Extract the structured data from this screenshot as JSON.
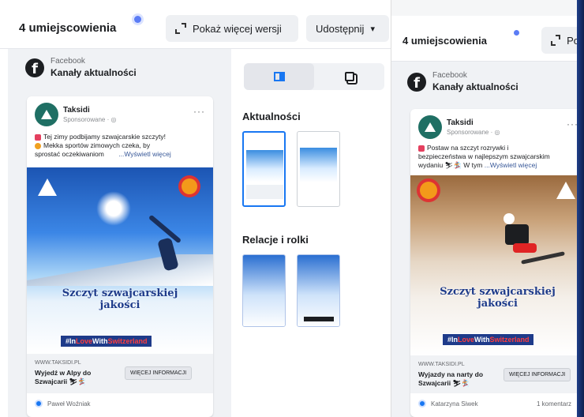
{
  "left": {
    "locations_title": "4 umiejscowienia",
    "show_more_versions": "Pokaż więcej wersji",
    "share_label": "Udostępnij",
    "share_caret": "▾",
    "platform": "Facebook",
    "placement_name": "Kanały aktualności",
    "fb_glyph": "f",
    "post": {
      "brand": "Taksidi",
      "sponsored": "Sponsorowane · ◎",
      "menu": "···",
      "caption_line1": "Tej zimy podbijamy szwajcarskie szczyty!",
      "caption_line2": "Mekka sportów zimowych czeka, by",
      "caption_line3": "sprostać oczekiwaniom",
      "see_more": "...Wyświetl więcej",
      "headline_line1": "Szczyt szwajcarskiej",
      "headline_line2": "jakości",
      "hashtag_a": "#In",
      "hashtag_b": "Love",
      "hashtag_c": "With",
      "hashtag_d": "Switzerland",
      "domain": "WWW.TAKSIDI.PL",
      "cta_title_line1": "Wyjedź w Alpy do",
      "cta_title_line2": "Szwajcarii ⛷🏂",
      "cta_button": "WIĘCEJ INFORMACJI",
      "commenter": "Paweł Woźniak"
    },
    "placements": {
      "feeds_label": "Aktualności",
      "stories_label": "Relacje i rolki"
    }
  },
  "right": {
    "locations_title": "4 umiejscowienia",
    "partial_button": "Po",
    "platform": "Facebook",
    "placement_name": "Kanały aktualności",
    "fb_glyph": "f",
    "post": {
      "brand": "Taksidi",
      "sponsored": "Sponsorowane · ◎",
      "menu": "···",
      "caption_line1": "Postaw na szczyt rozrywki i",
      "caption_line2": "bezpieczeństwa w najlepszym szwajcarskim",
      "caption_line3": "wydaniu ⛷🏂 W tym",
      "see_more": "...Wyświetl więcej",
      "headline_line1": "Szczyt szwajcarskiej",
      "headline_line2": "jakości",
      "hashtag_a": "#In",
      "hashtag_b": "Love",
      "hashtag_c": "With",
      "hashtag_d": "Switzerland",
      "domain": "WWW.TAKSIDI.PL",
      "cta_title_line1": "Wyjazdy na narty do",
      "cta_title_line2": "Szwajcarii ⛷🏂",
      "cta_button": "WIĘCEJ INFORMACJI",
      "commenter": "Katarzyna Siwek",
      "comments": "1 komentarz"
    }
  },
  "colors": {
    "accent": "#1877f2",
    "headline": "#1e3b8a",
    "brand_green": "#1f6f64"
  }
}
